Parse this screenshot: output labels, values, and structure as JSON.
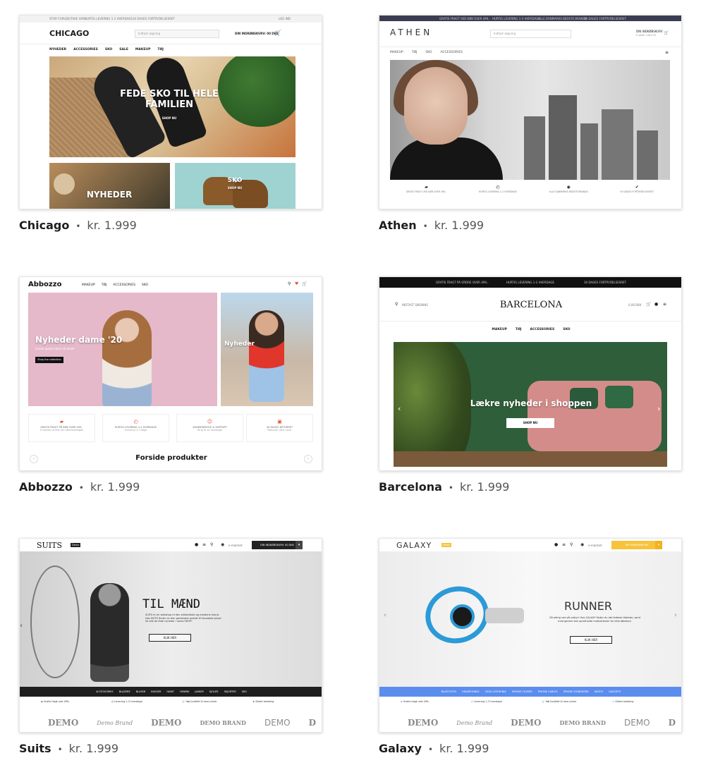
{
  "separator": "•",
  "themes": [
    {
      "name": "Chicago",
      "price": "kr. 1.999",
      "preview": {
        "topbar": [
          "STOR FORUDE/TAKE VARE",
          "HURTIG LEVERING 1-2 HVERDAGE",
          "30 DAGES FORTRYDELSESRET"
        ],
        "topbar_right": "LOG IND",
        "logo": "CHICAGO",
        "search_placeholder": "Indtast søgning",
        "cart": "DIN INDKØBSKURV: 00 DKK",
        "nav": [
          "NYHEDER",
          "ACCESSORIES",
          "SKO",
          "SALE",
          "MAKEUP",
          "TØJ"
        ],
        "hero_title": "FEDE SKO TIL HELE FAMILIEN",
        "hero_cta": "SHOP NU",
        "tile1": "NYHEDER",
        "tile2": "SKO",
        "tile2_sub": "SHOP NU"
      }
    },
    {
      "name": "Athen",
      "price": "kr. 1.999",
      "preview": {
        "topbar": [
          "GRATIS FRAGT VED KØB OVER 499,-",
          "HURTIG LEVERING 1-2 HVERDAGE",
          "ALLE DANMARKS BEDSTE BRANDS",
          "30 DAGES FORTRYDELSESRET"
        ],
        "logo": "ATHEN",
        "search_placeholder": "Indtast søgning",
        "cart": "DIN INDKØBSKURV",
        "cart_sub": "0 varer i alt 0 kr",
        "nav": [
          "MAKEUP",
          "TØJ",
          "SKO",
          "ACCESSORIES"
        ],
        "features": [
          "GRATIS FRAGT VED KØB OVER 499,-",
          "HURTIG LEVERING 1-2 HVERDAGE",
          "ALLE DANMARKS BEDSTE BRANDS",
          "30 DAGES FORTRYDELSESRET"
        ]
      }
    },
    {
      "name": "Abbozzo",
      "price": "kr. 1.999",
      "preview": {
        "logo": "Abbozzo",
        "nav": [
          "MAKEUP",
          "TØJ",
          "ACCESSORIES",
          "SKO"
        ],
        "hero_title": "Nyheder dame '20",
        "hero_sub": "Lorem ipsum dolor sit amet",
        "hero_cta": "Shop the collection",
        "hero2_title": "Nyheder",
        "features": [
          "GRATIS FRAGT PÅ KØB OVER 499,-",
          "HURTIG LEVERING 1-2 HVERDAGE",
          "KUNDESERVICE & SUPPORT",
          "30 DAGES RETURRET"
        ],
        "feature_subs": [
          "Vi sender ordrer om eftermiddagen",
          "Levering 1-2 dage",
          "Ring til os hverdage",
          "Returnér dine varer"
        ],
        "section_title": "Forside produkter"
      }
    },
    {
      "name": "Barcelona",
      "price": "kr. 1.999",
      "preview": {
        "topbar": [
          "GRATIS FRAGT PÅ ORDRE OVER 499,-",
          "HURTIG LEVERING 1-2 HVERDAGE",
          "30 DAGES FORTRYDELSESRET"
        ],
        "search_placeholder": "INDTAST SØGNING",
        "logo": "BARCELONA",
        "cart": "0,00 DKK",
        "nav": [
          "MAKEUP",
          "TØJ",
          "ACCESSORIES",
          "SKO"
        ],
        "hero_title": "Lækre nyheder i shoppen",
        "hero_cta": "SHOP NU"
      }
    },
    {
      "name": "Suits",
      "price": "kr. 1.999",
      "preview": {
        "logo": "SUITS",
        "logo_badge": "Demo",
        "eye_label": "e-mærket",
        "cart": "DIN INDKØBSKURV: 00 DKK",
        "hero_title": "TIL MÆND",
        "hero_text": "SUITS er en webshop til den stilbevidste og moderne mand. Hos SUITS finder du den garderobe samlet til favorable priser. Se alle de fede nyheder i vores SHOP!",
        "hero_cta": "KLIK HER",
        "categories": [
          "ACCESSORIES",
          "BLAZERE",
          "BLUSER",
          "BUKSER",
          "HABIT",
          "HENRIK",
          "JAKKER",
          "KJOLER",
          "SKJORTER",
          "SKO"
        ],
        "perks": [
          "Gratis fragt ved 499,-",
          "Levering 1-3 hverdage",
          "Høj kvalitet til lave priser",
          "Sikker betaling"
        ],
        "brands": [
          "DEMO",
          "Demo Brand",
          "DEMO",
          "DEMO BRAND",
          "DEMO",
          "D"
        ]
      }
    },
    {
      "name": "Galaxy",
      "price": "kr. 1.999",
      "preview": {
        "logo": "GALAXY",
        "logo_badge": "Demo",
        "eye_label": "e-mærket",
        "cart": "DIN INDKØBSKURV",
        "hero_title": "RUNNER",
        "hero_text": "Gå aldrig ned på udstyr! Hos GALAXY finder du det fedeste tilbehør, samt med garanti kan opretholde motivationen for dine løbeture.",
        "hero_cta": "KLIK HER",
        "categories": [
          "BLUETOOTH",
          "HEADPHONES",
          "LYDIS LEKTRONIK",
          "IPHONE COVERS",
          "IPHONE CABLES",
          "IPHONE STANDERRD",
          "WATCH",
          "GADGETS"
        ],
        "perks": [
          "Gratis fragt ved 499,-",
          "Levering 1-3 hverdage",
          "Høj kvalitet til lave priser",
          "Sikker betaling"
        ],
        "brands": [
          "DEMO",
          "Demo Brand",
          "DEMO",
          "DEMO BRAND",
          "DEMO",
          "D"
        ]
      },
      "accent": "#f6c33a",
      "catbar_color": "#5b8def"
    }
  ]
}
